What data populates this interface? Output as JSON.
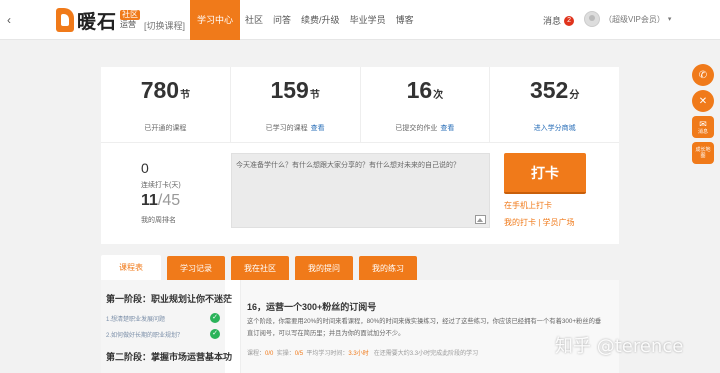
{
  "header": {
    "back_icon": "‹",
    "logo_text": "暖石",
    "logo_badge": "社区",
    "logo_school": "运营",
    "switch_course": "[切换课程]",
    "nav": [
      {
        "label": "学习中心",
        "active": true
      },
      {
        "label": "社区",
        "active": false
      },
      {
        "label": "问答",
        "active": false
      },
      {
        "label": "续费/升级",
        "active": false
      },
      {
        "label": "毕业学员",
        "active": false
      },
      {
        "label": "博客",
        "active": false
      }
    ],
    "messages_label": "消息",
    "messages_count": "2",
    "user_label": "（超级VIP会员）",
    "caret": "▾"
  },
  "stats": [
    {
      "value": "780",
      "unit": "节",
      "caption": "已开通的课程",
      "link": ""
    },
    {
      "value": "159",
      "unit": "节",
      "caption": "已学习的课程",
      "link": "查看"
    },
    {
      "value": "16",
      "unit": "次",
      "caption": "已提交的作业",
      "link": "查看"
    },
    {
      "value": "352",
      "unit": "分",
      "caption": "进入学分商城",
      "link": ""
    }
  ],
  "checkin": {
    "streak_value": "0",
    "streak_label": "连续打卡(天)",
    "rank_value": "11",
    "rank_total": "/45",
    "rank_label": "我的周排名",
    "placeholder": "今天准备学什么？有什么想跟大家分享的？有什么想对未来的自己说的？",
    "button_label": "打卡",
    "mobile_link": "在手机上打卡",
    "my_checkin_link": "我的打卡",
    "separator": " | ",
    "square_link": "学员广场"
  },
  "tabs": [
    {
      "label": "课程表",
      "active": true
    },
    {
      "label": "学习记录",
      "active": false
    },
    {
      "label": "我在社区",
      "active": false
    },
    {
      "label": "我的提问",
      "active": false
    },
    {
      "label": "我的练习",
      "active": false
    }
  ],
  "sidebar": {
    "stage1_title": "第一阶段：职业规划让你不迷茫",
    "stage1_items": [
      "1.想清楚职业发展问题",
      "2.如何做好长期的职业规划？"
    ],
    "stage2_title": "第二阶段：掌握市场运营基本功",
    "check_icon": "✓"
  },
  "lesson": {
    "title": "16，运营一个300+粉丝的订阅号",
    "description": "这个阶段，你需要用20%的时间来看课程，80%的时间来做实操练习，经过了这些练习，你应该已经拥有一个有着300+粉丝的垂直订阅号，可以写在简历里；并且为你的面试加分不少。",
    "meta": {
      "course_label": "课程：",
      "course_value": "0/0",
      "practice_label": "实操：",
      "practice_value": "0/5",
      "avg_label": "平均学习时间：",
      "avg_value": "3.3小时",
      "note": "在还需要大约3.3小时完成此阶段的学习"
    }
  },
  "float_bar": {
    "phone_icon": "✆",
    "cross_icon": "✕",
    "mail_label": "消息",
    "mail_icon": "✉",
    "growth_label": "成长地图"
  },
  "watermark": "知乎 @terence"
}
